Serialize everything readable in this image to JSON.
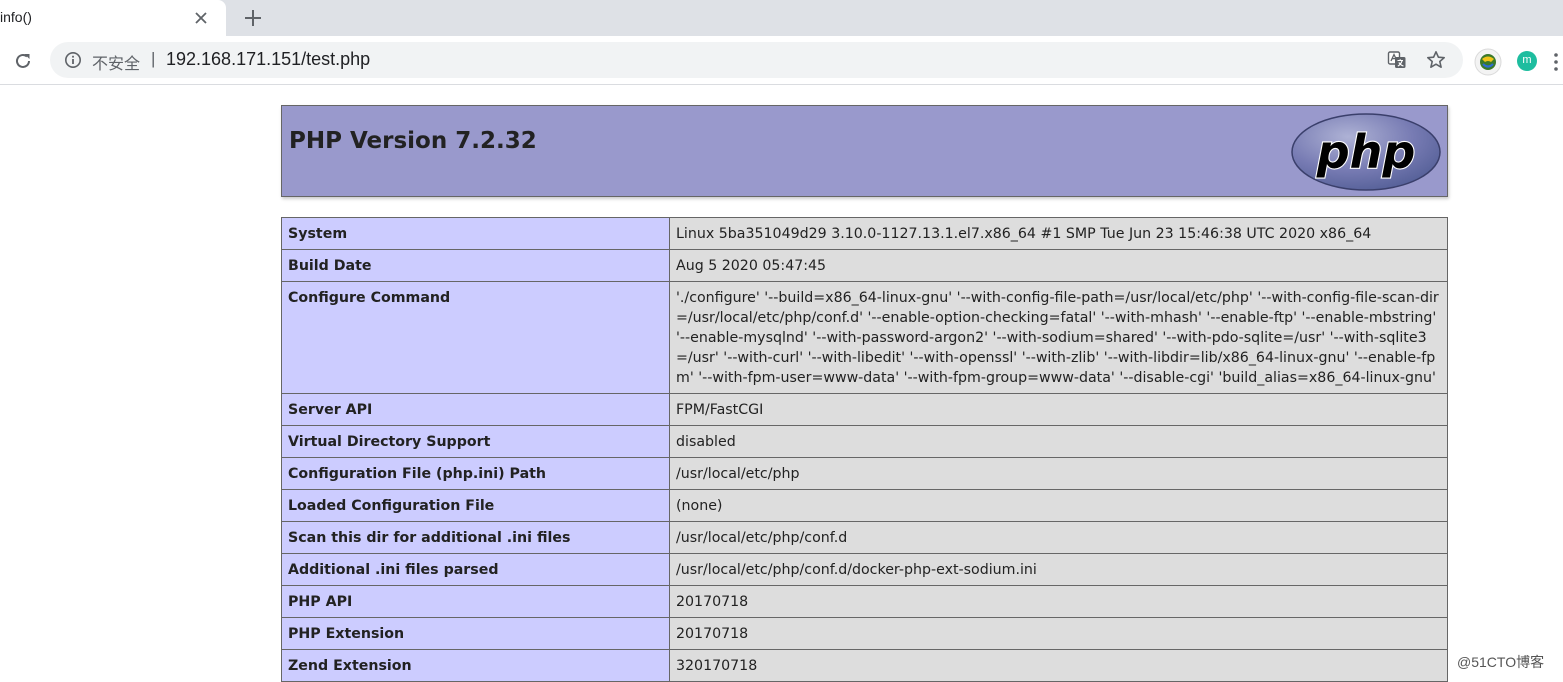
{
  "browser": {
    "tab_title": "info()",
    "security_label": "不安全",
    "url_separator": "|",
    "url": "192.168.171.151/test.php",
    "profile_initial": "m"
  },
  "phpinfo": {
    "title": "PHP Version 7.2.32",
    "logo_text": "php",
    "rows": [
      {
        "key": "System",
        "value": "Linux 5ba351049d29 3.10.0-1127.13.1.el7.x86_64 #1 SMP Tue Jun 23 15:46:38 UTC 2020 x86_64"
      },
      {
        "key": "Build Date",
        "value": "Aug 5 2020 05:47:45"
      },
      {
        "key": "Configure Command",
        "value": "'./configure' '--build=x86_64-linux-gnu' '--with-config-file-path=/usr/local/etc/php' '--with-config-file-scan-dir=/usr/local/etc/php/conf.d' '--enable-option-checking=fatal' '--with-mhash' '--enable-ftp' '--enable-mbstring' '--enable-mysqlnd' '--with-password-argon2' '--with-sodium=shared' '--with-pdo-sqlite=/usr' '--with-sqlite3=/usr' '--with-curl' '--with-libedit' '--with-openssl' '--with-zlib' '--with-libdir=lib/x86_64-linux-gnu' '--enable-fpm' '--with-fpm-user=www-data' '--with-fpm-group=www-data' '--disable-cgi' 'build_alias=x86_64-linux-gnu'"
      },
      {
        "key": "Server API",
        "value": "FPM/FastCGI"
      },
      {
        "key": "Virtual Directory Support",
        "value": "disabled"
      },
      {
        "key": "Configuration File (php.ini) Path",
        "value": "/usr/local/etc/php"
      },
      {
        "key": "Loaded Configuration File",
        "value": "(none)"
      },
      {
        "key": "Scan this dir for additional .ini files",
        "value": "/usr/local/etc/php/conf.d"
      },
      {
        "key": "Additional .ini files parsed",
        "value": "/usr/local/etc/php/conf.d/docker-php-ext-sodium.ini"
      },
      {
        "key": "PHP API",
        "value": "20170718"
      },
      {
        "key": "PHP Extension",
        "value": "20170718"
      },
      {
        "key": "Zend Extension",
        "value": "320170718"
      }
    ]
  },
  "watermark": "@51CTO博客",
  "colors": {
    "header_bg": "#9999cc",
    "key_cell_bg": "#ccccff",
    "value_cell_bg": "#dddddd",
    "border": "#666666"
  },
  "icons": [
    "close-icon",
    "plus-icon",
    "reload-icon",
    "info-icon",
    "translate-icon",
    "star-icon",
    "extension-icon",
    "more-vert-icon"
  ]
}
